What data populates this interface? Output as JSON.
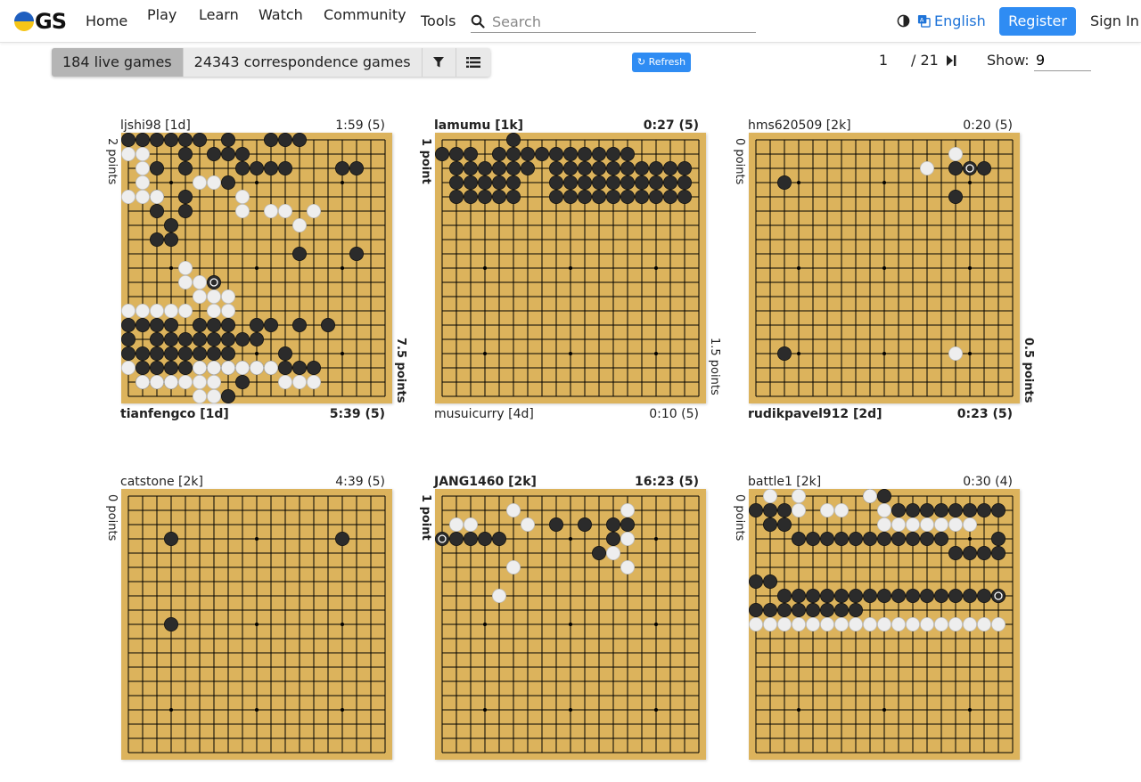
{
  "nav": {
    "logo_text": "GS",
    "home": "Home",
    "play": "Play",
    "learn": "Learn",
    "watch": "Watch",
    "community": "Community",
    "tools": "Tools",
    "search_placeholder": "Search",
    "language": "English",
    "register": "Register",
    "sign_in": "Sign In"
  },
  "toolbar": {
    "live_games": "184 live games",
    "correspondence_games": "24343 correspondence games",
    "filter_icon": "filter-icon",
    "list_icon": "list-icon",
    "refresh": "Refresh",
    "page_current": "1",
    "page_total": "/  21",
    "show_label": "Show:",
    "show_value": "9"
  },
  "colors": {
    "accent": "#2f8cf3",
    "board": "#dcb35c",
    "link": "#1e73d8"
  },
  "games": [
    {
      "top_player": "ljshi98  [1d]",
      "top_time": "1:59  (5)",
      "top_bold": false,
      "bottom_player": "tianfengco  [1d]",
      "bottom_time": "5:39  (5)",
      "bottom_bold": true,
      "top_score": "2 points",
      "top_score_bold": false,
      "top_score_side": "left",
      "bottom_score": "7.5 points",
      "bottom_score_bold": true,
      "bottom_score_side": "right",
      "black": "A1,B1,C1,D1,E1,F1,H1,I1,L1,M1,N1,E2,G2,H2,I2,J2,C3,E3,J3,K3,L3,M3,Q3,R3,H4,C5,E5,C6,E6,D7,C8,D8,I8,N9,R9,A14,B14,C14,D14,F14,G14,H14,K14,L14,N14,P14,A15,C15,D15,E15,F15,G15,H15,I15,J15,K15,A16,B16,C16,D16,E16,F16,G16,H16,M16,B17,C17,D17,E17,F17,G17,H17,I17,J17,K17,L17,M17,N17,O17,B18,C18,D18,J18,H19",
      "white": "A2,B2,B3,B4,F4,G4,A5,B5,C5,J5,J6,L6,M6,O6,N7,E10,E11,F11,F12,G12,H12,H13,A13,B13,C13,D13,E13,G13,A17,F17,G17,H17,I17,J17,K17,L17,B18,C18,D18,E18,F18,G18,M18,N18,O18,F19,G19",
      "last": "G11"
    },
    {
      "top_player": "lamumu  [1k]",
      "top_time": "0:27  (5)",
      "top_bold": true,
      "bottom_player": "musuicurry  [4d]",
      "bottom_time": "0:10  (5)",
      "bottom_bold": false,
      "top_score": "1 point",
      "top_score_bold": true,
      "top_score_side": "left",
      "bottom_score": "1.5 points",
      "bottom_score_bold": false,
      "bottom_score_side": "right",
      "black": "F1,A2,B2,C2,E2,F2,G2,H2,I2,J2,K2,L2,M2,N2,O2,B3,C3,D3,E3,F3,G3,I3,J3,K3,L3,M3,N3,O3,P3,Q3,R3,S3,B4,C4,D4,E4,F4,I4,J4,K4,L4,M4,N4,O4,P4,Q4,R4,S4,B5,C5,D5,E5,F5,J5,K5,L5,M5,N5,O5,P5,Q5,R5,S5",
      "white": "",
      "last": ""
    },
    {
      "top_player": "hms620509  [2k]",
      "top_time": "0:20  (5)",
      "top_bold": false,
      "bottom_player": "rudikpavel912  [2d]",
      "bottom_time": "0:23  (5)",
      "bottom_bold": true,
      "top_score": "0 points",
      "top_score_bold": false,
      "top_score_side": "left",
      "bottom_score": "0.5 points",
      "bottom_score_bold": true,
      "bottom_score_side": "right",
      "black": "C4,P3,P5,C16,R3",
      "white": "P2,N3,P16",
      "last": "Q3"
    },
    {
      "top_player": "catstone  [2k]",
      "top_time": "4:39  (5)",
      "top_bold": false,
      "bottom_player": "",
      "bottom_time": "",
      "bottom_bold": false,
      "top_score": "0 points",
      "top_score_bold": false,
      "top_score_side": "left",
      "bottom_score": "",
      "bottom_score_bold": false,
      "bottom_score_side": "right",
      "black": "D4,Q4,D10",
      "white": "",
      "last": ""
    },
    {
      "top_player": "JANG1460  [2k]",
      "top_time": "16:23  (5)",
      "top_bold": true,
      "bottom_player": "",
      "bottom_time": "",
      "bottom_bold": false,
      "top_score": "1 point",
      "top_score_bold": true,
      "top_score_side": "left",
      "bottom_score": "",
      "bottom_score_bold": false,
      "bottom_score_side": "right",
      "black": "B4,C4,D4,E4,J3,L3,N3,O3,N4,M5",
      "white": "B3,C3,F2,G3,O2,O4,N5,O6,F6,E8",
      "last": "A4"
    },
    {
      "top_player": "battle1  [2k]",
      "top_time": "0:30  (4)",
      "top_bold": false,
      "bottom_player": "",
      "bottom_time": "",
      "bottom_bold": false,
      "top_score": "0 points",
      "top_score_bold": false,
      "top_score_side": "left",
      "bottom_score": "",
      "bottom_score_bold": false,
      "bottom_score_side": "right",
      "black": "A2,B2,C2,J1,K1,L2,M2,N2,O2,P2,Q2,R2,S2,B3,C3,D4,E4,F4,G4,H4,I4,J4,K4,L4,M4,N4,O4,S4,P5,Q5,R5,S5,A7,B7,C8,D8,E8,F8,G8,H8,J8,K8,L8,M8,N8,O8,P8,Q8,R8,S8,A9,B9,C9,D9,E9,F9,G9,H9,I9",
      "white": "B1,D1,J1,K2,D2,F2,G2,I2,K3,L3,M3,N3,O3,P3,Q3,A10,B10,C10,D10,E10,F10,G10,H10,I10,J10,K10,L10,M10,N10,O10,P10,Q10,R10,S10",
      "last": "S8"
    }
  ]
}
